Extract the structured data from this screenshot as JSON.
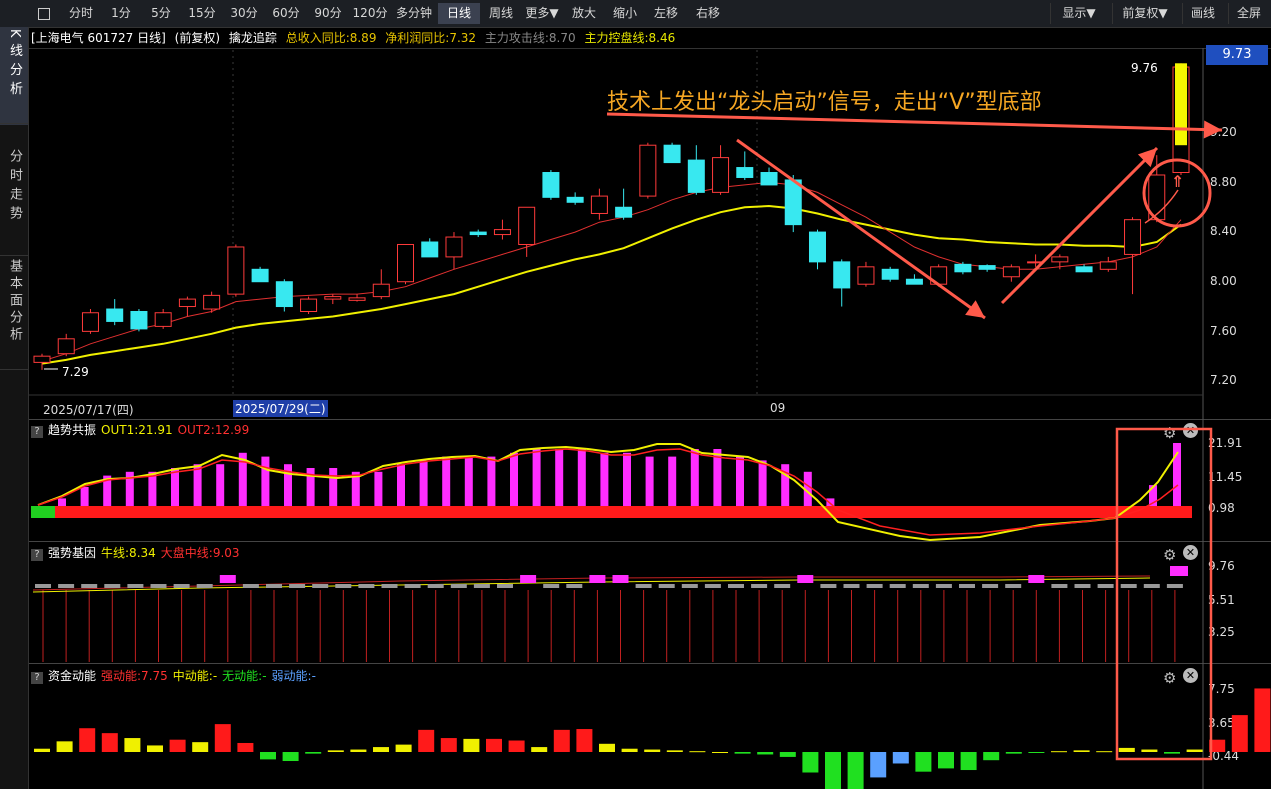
{
  "toolbar": {
    "buttons": [
      "分时",
      "1分",
      "5分",
      "15分",
      "30分",
      "60分",
      "90分",
      "120分",
      "多分钟",
      "日线",
      "周线",
      "更多▼",
      "放大",
      "缩小",
      "左移",
      "右移"
    ],
    "active_index": 9,
    "right_buttons": [
      "显示▼",
      "前复权▼",
      "画线",
      "全屏"
    ]
  },
  "sidebar": [
    {
      "label": "K线分析",
      "active": true
    },
    {
      "label": "分时走势",
      "active": false
    },
    {
      "label": "基本面分析",
      "active": false
    }
  ],
  "main_panel": {
    "header": [
      "[上海电气 601727 日线]",
      "(前复权)",
      "擒龙追踪",
      "总收入同比:8.89",
      "净利润同比:7.32",
      "主力攻击线:8.70",
      "主力控盘线:8.46"
    ],
    "header_colors": [
      "#ffffff",
      "#ffffff",
      "#ffffff",
      "#e7c400",
      "#e7c400",
      "#888888",
      "#e7e700"
    ],
    "price_labels": [
      "9.20",
      "8.80",
      "8.40",
      "8.00",
      "7.60",
      "7.20"
    ],
    "current_price": "9.73",
    "high_label": "9.76",
    "low_label": "7.29",
    "annotation": "技术上发出“龙头启动”信号，走出“V”型底部",
    "annotation_color": "#f5a623",
    "marker_icon": "rocket-icon"
  },
  "date_axis": {
    "date1": "2025/07/17(四)",
    "date2": "2025/07/29(二)",
    "date3": "09"
  },
  "panel1": {
    "title": "趋势共振",
    "out1": "OUT1:21.91",
    "out2": "OUT2:12.99",
    "axis": [
      "21.91",
      "11.45",
      "0.98"
    ]
  },
  "panel2": {
    "title": "强势基因",
    "bull": "牛线:8.34",
    "market": "大盘中线:9.03",
    "axis": [
      "9.76",
      "5.51",
      "3.25"
    ]
  },
  "panel3": {
    "title": "资金动能",
    "strong": "强动能:7.75",
    "mid": "中动能:-",
    "none": "无动能:-",
    "weak": "弱动能:-",
    "axis": [
      "7.75",
      "3.65",
      "-0.44"
    ]
  },
  "colors": {
    "up": "#ff3b3b",
    "down": "#38e8f0",
    "ma_short": "#e03030",
    "ma_long": "#f0f000",
    "magenta": "#ff2dff",
    "highlight": "#ff5a4a"
  },
  "chart_data": {
    "type": "candlestick",
    "candles": [
      [
        7.35,
        7.42,
        7.29,
        7.4
      ],
      [
        7.42,
        7.58,
        7.4,
        7.54
      ],
      [
        7.6,
        7.78,
        7.58,
        7.75
      ],
      [
        7.78,
        7.86,
        7.65,
        7.68
      ],
      [
        7.76,
        7.78,
        7.6,
        7.62
      ],
      [
        7.64,
        7.78,
        7.62,
        7.75
      ],
      [
        7.8,
        7.88,
        7.72,
        7.86
      ],
      [
        7.78,
        7.92,
        7.75,
        7.89
      ],
      [
        7.9,
        8.3,
        7.88,
        8.28
      ],
      [
        8.1,
        8.12,
        8.02,
        8.0
      ],
      [
        8.0,
        8.02,
        7.76,
        7.8
      ],
      [
        7.76,
        7.88,
        7.74,
        7.86
      ],
      [
        7.86,
        7.9,
        7.82,
        7.88
      ],
      [
        7.85,
        7.9,
        7.84,
        7.87
      ],
      [
        7.88,
        8.1,
        7.86,
        7.98
      ],
      [
        8.0,
        8.3,
        7.98,
        8.3
      ],
      [
        8.32,
        8.35,
        8.2,
        8.2
      ],
      [
        8.2,
        8.4,
        8.1,
        8.36
      ],
      [
        8.4,
        8.42,
        8.36,
        8.38
      ],
      [
        8.38,
        8.5,
        8.34,
        8.42
      ],
      [
        8.3,
        8.6,
        8.2,
        8.6
      ],
      [
        8.88,
        8.9,
        8.66,
        8.68
      ],
      [
        8.68,
        8.72,
        8.62,
        8.64
      ],
      [
        8.55,
        8.75,
        8.5,
        8.69
      ],
      [
        8.6,
        8.75,
        8.5,
        8.52
      ],
      [
        8.69,
        9.12,
        8.67,
        9.1
      ],
      [
        9.1,
        9.12,
        8.96,
        8.96
      ],
      [
        8.98,
        9.1,
        8.7,
        8.72
      ],
      [
        8.72,
        9.1,
        8.7,
        9.0
      ],
      [
        8.92,
        9.05,
        8.82,
        8.84
      ],
      [
        8.88,
        8.92,
        8.78,
        8.78
      ],
      [
        8.82,
        8.86,
        8.4,
        8.46
      ],
      [
        8.4,
        8.42,
        8.1,
        8.16
      ],
      [
        8.16,
        8.18,
        7.8,
        7.95
      ],
      [
        7.98,
        8.16,
        7.96,
        8.12
      ],
      [
        8.1,
        8.12,
        8.0,
        8.02
      ],
      [
        8.02,
        8.06,
        7.98,
        7.98
      ],
      [
        7.98,
        8.14,
        7.96,
        8.12
      ],
      [
        8.14,
        8.16,
        8.06,
        8.08
      ],
      [
        8.13,
        8.14,
        8.08,
        8.1
      ],
      [
        8.04,
        8.14,
        8.0,
        8.12
      ],
      [
        8.16,
        8.22,
        8.12,
        8.16
      ],
      [
        8.16,
        8.22,
        8.1,
        8.2
      ],
      [
        8.12,
        8.14,
        8.08,
        8.08
      ],
      [
        8.1,
        8.2,
        8.08,
        8.16
      ],
      [
        8.22,
        8.52,
        7.9,
        8.5
      ],
      [
        8.5,
        9.02,
        8.48,
        8.86
      ],
      [
        8.88,
        9.76,
        8.86,
        9.73
      ]
    ],
    "ma_short": [
      7.36,
      7.42,
      7.5,
      7.56,
      7.62,
      7.66,
      7.72,
      7.76,
      7.84,
      7.86,
      7.88,
      7.89,
      7.9,
      7.9,
      7.92,
      7.96,
      8.03,
      8.1,
      8.16,
      8.22,
      8.28,
      8.34,
      8.4,
      8.48,
      8.52,
      8.58,
      8.66,
      8.72,
      8.76,
      8.78,
      8.8,
      8.78,
      8.72,
      8.62,
      8.52,
      8.4,
      8.28,
      8.2,
      8.14,
      8.12,
      8.1,
      8.1,
      8.12,
      8.14,
      8.16,
      8.2,
      8.28,
      8.5
    ],
    "ma_long": [
      7.34,
      7.37,
      7.41,
      7.44,
      7.47,
      7.5,
      7.54,
      7.58,
      7.63,
      7.66,
      7.68,
      7.7,
      7.72,
      7.75,
      7.78,
      7.82,
      7.86,
      7.9,
      7.96,
      8.02,
      8.08,
      8.13,
      8.18,
      8.22,
      8.27,
      8.35,
      8.43,
      8.5,
      8.56,
      8.6,
      8.61,
      8.59,
      8.55,
      8.5,
      8.46,
      8.42,
      8.38,
      8.35,
      8.34,
      8.32,
      8.31,
      8.3,
      8.3,
      8.29,
      8.29,
      8.28,
      8.32,
      8.46
    ],
    "trend_bars": [
      2,
      4,
      7,
      8,
      8,
      9,
      10,
      10,
      13,
      12,
      10,
      9,
      9,
      8,
      8,
      10,
      11,
      12,
      12,
      12,
      13,
      14,
      14,
      14,
      13,
      13,
      12,
      12,
      14,
      14,
      12,
      11,
      10,
      8,
      2,
      0,
      0,
      0,
      0,
      0,
      0,
      0,
      0,
      0,
      0,
      0,
      0,
      0,
      0,
      0,
      0,
      0,
      0,
      0,
      0,
      0,
      0,
      0,
      0,
      0,
      8,
      21.91
    ],
    "money_bars": [
      0.4,
      1.3,
      2.9,
      2.3,
      1.7,
      0.8,
      1.5,
      1.2,
      3.4,
      1.1,
      -0.9,
      -1.1,
      -0.2,
      0.2,
      0.3,
      0.6,
      0.9,
      2.7,
      1.7,
      1.6,
      1.6,
      1.4,
      0.6,
      2.7,
      2.8,
      1.0,
      0.4,
      0.3,
      0.2,
      0.1,
      0.0,
      -0.2,
      -0.3,
      -0.6,
      -2.5,
      -4.7,
      -5.3,
      -3.1,
      -1.4,
      -2.4,
      -2.0,
      -2.2,
      -1.0,
      -0.2,
      -0.1,
      0.1,
      0.2,
      0.1,
      0.5,
      0.3,
      -0.2,
      0.3,
      1.5,
      4.5,
      7.75
    ]
  }
}
